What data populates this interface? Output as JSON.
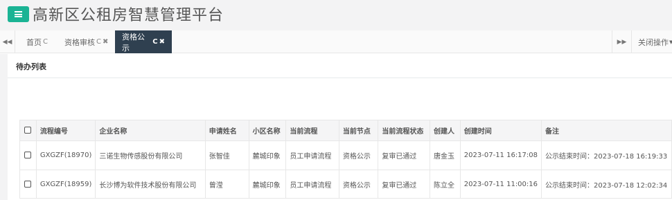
{
  "header": {
    "title": "高新区公租房智慧管理平台"
  },
  "tabs": [
    {
      "label": "首页",
      "refresh": "C",
      "close": ""
    },
    {
      "label": "资格审核",
      "refresh": "C",
      "close": "✖"
    },
    {
      "label": "资格公示",
      "refresh": "C",
      "close": "✖"
    }
  ],
  "tab_nav": {
    "left_icon": "backward-icon",
    "right_icon": "forward-icon",
    "close_ops_label": "关闭操作"
  },
  "panel": {
    "title": "待办列表"
  },
  "table": {
    "headers": [
      "流程编号",
      "企业名称",
      "申请姓名",
      "小区名称",
      "当前流程",
      "当前节点",
      "当前流程状态",
      "创建人",
      "创建时间",
      "备注"
    ],
    "rows": [
      [
        "GXGZF(18970)",
        "三诺生物传感股份有限公司",
        "张智佳",
        "麓城印象",
        "员工申请流程",
        "资格公示",
        "复审已通过",
        "唐金玉",
        "2023-07-11 16:17:08",
        "公示结束时间：2023-07-18 16:19:33"
      ],
      [
        "GXGZF(18959)",
        "长沙博为软件技术股份有限公司",
        "曾滢",
        "麓城印象",
        "员工申请流程",
        "资格公示",
        "复审已通过",
        "陈立全",
        "2023-07-11 11:00:16",
        "公示结束时间：2023-07-18 12:02:34"
      ]
    ]
  },
  "colors": {
    "accent": "#1ab394",
    "active_tab": "#2f4050"
  }
}
